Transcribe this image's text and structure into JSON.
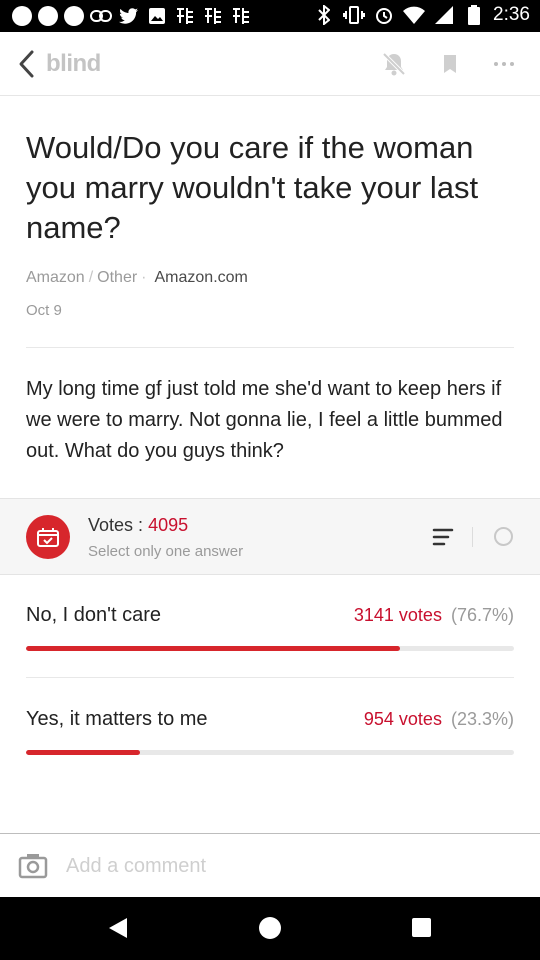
{
  "status_bar": {
    "time": "2:36",
    "left_icons": [
      "messenger-icon",
      "messenger-icon",
      "pinterest-icon",
      "link-icon",
      "twitter-icon",
      "image-icon",
      "app-icon",
      "app-icon",
      "app-icon"
    ],
    "right_icons": [
      "bluetooth-icon",
      "vibrate-icon",
      "alarm-icon",
      "wifi-icon",
      "signal-icon",
      "battery-icon"
    ]
  },
  "app_bar": {
    "logo": "blind",
    "icons": [
      "back-icon",
      "bell-off-icon",
      "bookmark-icon",
      "more-icon"
    ]
  },
  "post": {
    "title": "Would/Do you care if the woman you marry wouldn't take your last name?",
    "company": "Amazon",
    "sep1": "/",
    "channel": "Other",
    "sep2": "·",
    "author_company": "Amazon.com",
    "date": "Oct 9",
    "body": "My long time gf just told me she'd want to keep hers if we were to marry. Not gonna lie, I feel a little bummed out. What do you guys think?"
  },
  "poll": {
    "votes_label": "Votes :",
    "votes_count": "4095",
    "hint": "Select only one answer",
    "options": [
      {
        "label": "No, I don't care",
        "votes": "3141 votes",
        "percent_text": "(76.7%)",
        "fraction": 0.767
      },
      {
        "label": "Yes, it matters to me",
        "votes": "954 votes",
        "percent_text": "(23.3%)",
        "fraction": 0.233
      }
    ]
  },
  "comment": {
    "placeholder": "Add a comment"
  },
  "colors": {
    "accent": "#d7262c",
    "accent_text": "#c8102e",
    "muted": "#9a9a9a",
    "logo": "#c4c4c4"
  }
}
